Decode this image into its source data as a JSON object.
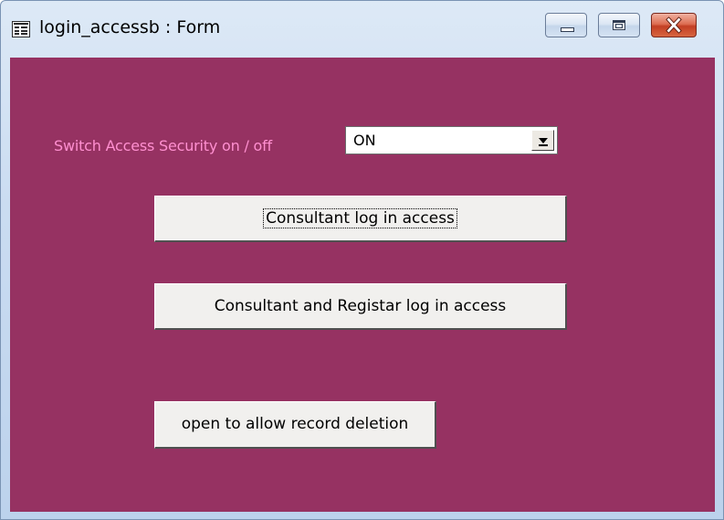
{
  "window": {
    "title": "login_accessb : Form"
  },
  "form": {
    "switch_label": "Switch Access Security on / off",
    "security_combo": {
      "value": "ON"
    },
    "buttons": {
      "consultant": "Consultant log in access",
      "consultant_registrar": "Consultant and Registar log in access",
      "record_deletion": "open to allow record deletion"
    }
  },
  "colors": {
    "form_background": "#963262",
    "label_text": "#ff8fd0",
    "button_face": "#f1f0ee",
    "titlebar": "#cadcf1",
    "close_button": "#c33f24"
  },
  "icons": {
    "app": "form-icon",
    "minimize": "minimize-icon",
    "maximize": "maximize-icon",
    "close": "close-icon",
    "dropdown": "dropdown-arrow-icon"
  }
}
